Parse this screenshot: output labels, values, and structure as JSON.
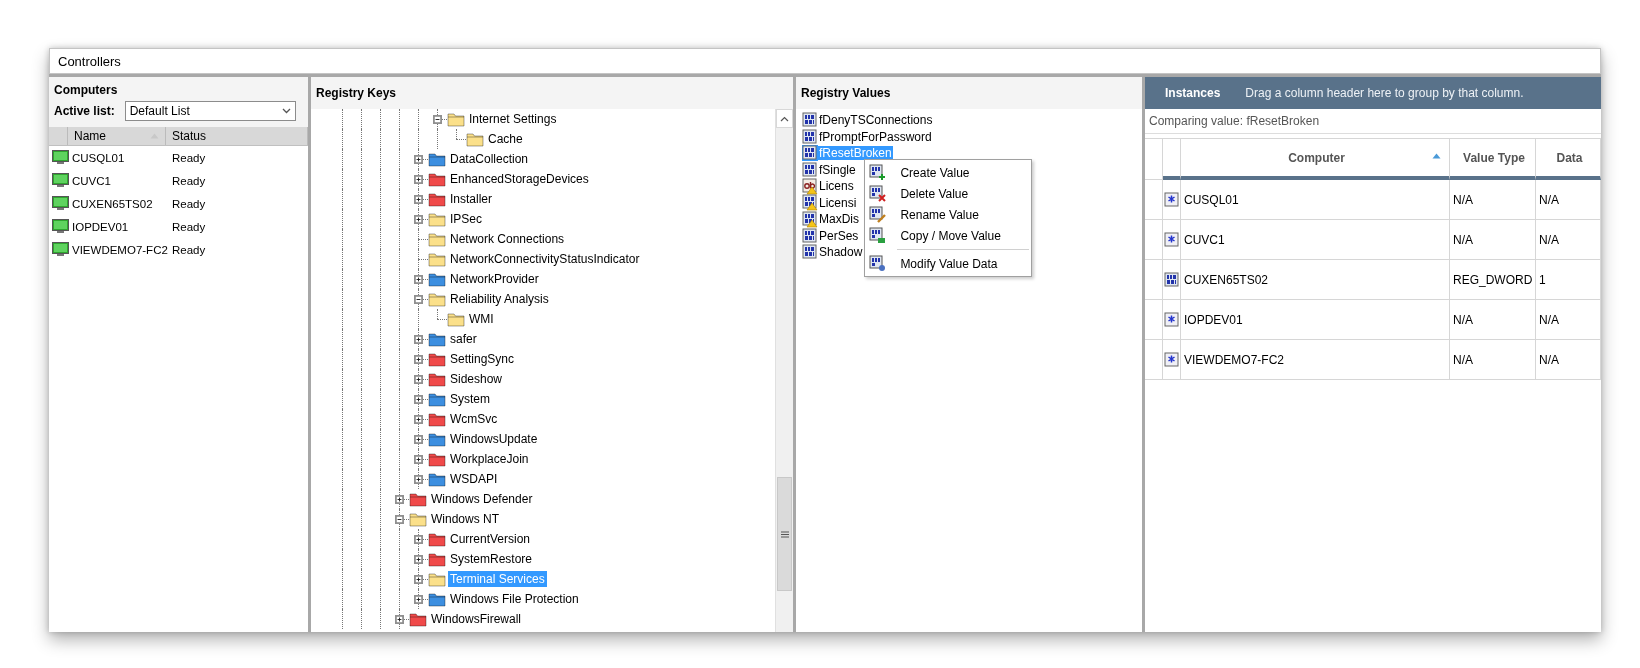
{
  "window": {
    "title": "Controllers"
  },
  "computers": {
    "title": "Computers",
    "active_list_label": "Active list:",
    "active_list": "Default List",
    "columns": [
      {
        "label": "Name",
        "sorted": true
      },
      {
        "label": "Status",
        "sorted": false
      }
    ],
    "rows": [
      {
        "name": "CUSQL01",
        "status": "Ready"
      },
      {
        "name": "CUVC1",
        "status": "Ready"
      },
      {
        "name": "CUXEN65TS02",
        "status": "Ready"
      },
      {
        "name": "IOPDEV01",
        "status": "Ready"
      },
      {
        "name": "VIEWDEMO7-FC2",
        "status": "Ready"
      }
    ]
  },
  "registry_keys": {
    "title": "Registry Keys",
    "items": [
      {
        "children": [
          {
            "children": [
              {
                "label": "Internet Settings",
                "color": "#fbe08a",
                "expanded": true,
                "selected": false,
                "children": [
                  {
                    "label": "Cache",
                    "color": "#fbe08a",
                    "selected": false
                  }
                ]
              }
            ]
          },
          {
            "label": "DataCollection",
            "color": "#3d8fe0",
            "expanded": false,
            "selected": false
          },
          {
            "label": "EnhancedStorageDevices",
            "color": "#f04a4a",
            "expanded": false,
            "selected": false
          },
          {
            "label": "Installer",
            "color": "#f04a4a",
            "expanded": false,
            "selected": false
          },
          {
            "label": "IPSec",
            "color": "#fbe08a",
            "expanded": false,
            "selected": false
          },
          {
            "label": "Network Connections",
            "color": "#fbe08a",
            "selected": false
          },
          {
            "label": "NetworkConnectivityStatusIndicator",
            "color": "#fbe08a",
            "selected": false
          },
          {
            "label": "NetworkProvider",
            "color": "#3d8fe0",
            "expanded": false,
            "selected": false
          },
          {
            "label": "Reliability Analysis",
            "color": "#fbe08a",
            "expanded": true,
            "selected": false,
            "children": [
              {
                "label": "WMI",
                "color": "#fbe08a",
                "selected": false
              }
            ]
          },
          {
            "label": "safer",
            "color": "#3d8fe0",
            "expanded": false,
            "selected": false
          },
          {
            "label": "SettingSync",
            "color": "#f04a4a",
            "expanded": false,
            "selected": false
          },
          {
            "label": "Sideshow",
            "color": "#f04a4a",
            "expanded": false,
            "selected": false
          },
          {
            "label": "System",
            "color": "#3d8fe0",
            "expanded": false,
            "selected": false
          },
          {
            "label": "WcmSvc",
            "color": "#f04a4a",
            "expanded": false,
            "selected": false
          },
          {
            "label": "WindowsUpdate",
            "color": "#3d8fe0",
            "expanded": false,
            "selected": false
          },
          {
            "label": "WorkplaceJoin",
            "color": "#f04a4a",
            "expanded": false,
            "selected": false
          },
          {
            "label": "WSDAPI",
            "color": "#3d8fe0",
            "expanded": false,
            "selected": false
          }
        ]
      },
      {
        "label": "Windows Defender",
        "color": "#f04a4a",
        "expanded": false,
        "selected": false
      },
      {
        "label": "Windows NT",
        "color": "#fbe08a",
        "expanded": true,
        "selected": false,
        "children": [
          {
            "label": "CurrentVersion",
            "color": "#f04a4a",
            "expanded": false,
            "selected": false
          },
          {
            "label": "SystemRestore",
            "color": "#f04a4a",
            "expanded": false,
            "selected": false
          },
          {
            "label": "Terminal Services",
            "color": "#fbe08a",
            "expanded": false,
            "selected": true
          },
          {
            "label": "Windows File Protection",
            "color": "#3d8fe0",
            "expanded": false,
            "selected": false
          }
        ]
      },
      {
        "label": "WindowsFirewall",
        "color": "#f04a4a",
        "expanded": false,
        "selected": false
      }
    ]
  },
  "registry_values": {
    "title": "Registry Values",
    "items": [
      {
        "name": "fDenyTSConnections",
        "kind": "binary",
        "selected": false
      },
      {
        "name": "fPromptForPassword",
        "kind": "binary",
        "selected": false
      },
      {
        "name": "fResetBroken",
        "kind": "binary",
        "selected": true
      },
      {
        "name": "fSingle",
        "kind": "binary",
        "selected": false
      },
      {
        "name": "Licens",
        "kind": "string-warning",
        "selected": false
      },
      {
        "name": "Licensi",
        "kind": "binary-warning",
        "selected": false
      },
      {
        "name": "MaxDis",
        "kind": "binary-warning",
        "selected": false
      },
      {
        "name": "PerSes",
        "kind": "binary",
        "selected": false
      },
      {
        "name": "Shadow",
        "kind": "binary",
        "selected": false
      }
    ],
    "context_menu": [
      {
        "label": "Create Value",
        "kind": "create",
        "separator_before": false
      },
      {
        "label": "Delete Value",
        "kind": "delete",
        "separator_before": false
      },
      {
        "label": "Rename Value",
        "kind": "rename",
        "separator_before": false
      },
      {
        "label": "Copy / Move Value",
        "kind": "copy",
        "separator_before": false
      },
      {
        "label": "Modify Value Data",
        "kind": "modify",
        "separator_before": true
      }
    ]
  },
  "instances": {
    "title": "Instances",
    "group_hint": "Drag a column header here to group by that column.",
    "comparing": "Comparing value: fResetBroken",
    "columns": [
      {
        "label": "Computer",
        "sorted": true
      },
      {
        "label": "Value Type",
        "sorted": false
      },
      {
        "label": "Data",
        "sorted": false
      }
    ],
    "rows": [
      {
        "kind": "missing",
        "computer": "CUSQL01",
        "value_type": "N/A",
        "data": "N/A"
      },
      {
        "kind": "missing",
        "computer": "CUVC1",
        "value_type": "N/A",
        "data": "N/A"
      },
      {
        "kind": "binary",
        "computer": "CUXEN65TS02",
        "value_type": "REG_DWORD",
        "data": "1"
      },
      {
        "kind": "missing",
        "computer": "IOPDEV01",
        "value_type": "N/A",
        "data": "N/A"
      },
      {
        "kind": "missing",
        "computer": "VIEWDEMO7-FC2",
        "value_type": "N/A",
        "data": "N/A"
      }
    ]
  }
}
